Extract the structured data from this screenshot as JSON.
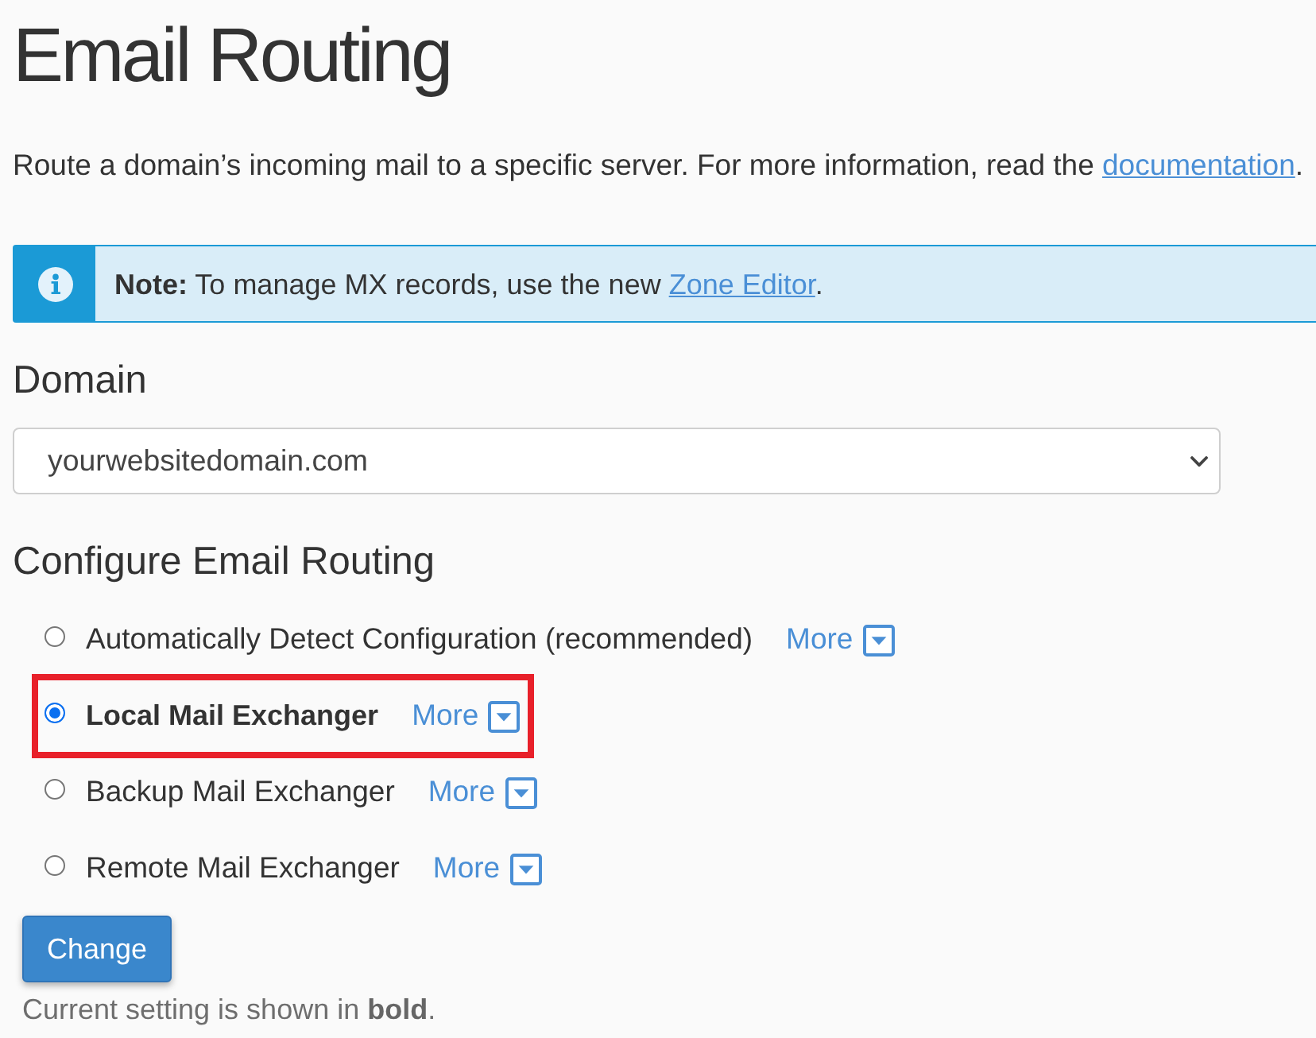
{
  "page": {
    "title": "Email Routing"
  },
  "intro": {
    "text": "Route a domain’s incoming mail to a specific server. For more information, read the ",
    "link": "documentation",
    "after": "."
  },
  "note": {
    "text": "**Note:** To manage MX records, use the new ",
    "link": "Zone Editor",
    "after": "."
  },
  "domain": {
    "heading": "Domain",
    "value": "yourwebsitedomain.com"
  },
  "routing": {
    "heading": "Configure Email Routing",
    "options": [
      {
        "label": "Automatically Detect Configuration (recommended)",
        "selected": false,
        "current": false,
        "highlighted": false,
        "more": "More"
      },
      {
        "label": "Local Mail Exchanger",
        "selected": true,
        "current": true,
        "highlighted": true,
        "more": "More"
      },
      {
        "label": "Backup Mail Exchanger",
        "selected": false,
        "current": false,
        "highlighted": false,
        "more": "More"
      },
      {
        "label": "Remote Mail Exchanger",
        "selected": false,
        "current": false,
        "highlighted": false,
        "more": "More"
      }
    ]
  },
  "button": "Change",
  "footnote": "Current setting is shown in **bold**."
}
